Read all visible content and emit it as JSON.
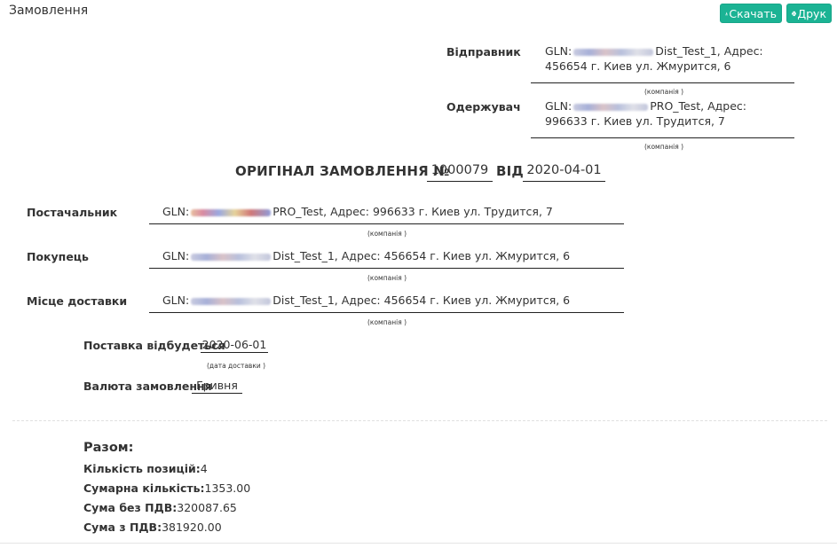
{
  "header": {
    "title": "Замовлення",
    "download_label": "Скачать",
    "print_label": "Друк",
    "accent_color": "#1bb394"
  },
  "sender": {
    "label": "Відправник",
    "gln_prefix": "GLN:",
    "line1_rest": "Dist_Test_1, Адрес:",
    "line2": "456654 г. Киев ул. Жмурится, 6",
    "caption": "(компанія )"
  },
  "recipient": {
    "label": "Одержувач",
    "gln_prefix": "GLN:",
    "line1_rest": "PRO_Test, Адрес:",
    "line2": "996633 г. Киев ул. Трудится, 7",
    "caption": "(компанія )"
  },
  "order_title": {
    "prefix": "ОРИГІНАЛ ЗАМОВЛЕННЯ №",
    "number": "1000079",
    "from_label": "ВІД",
    "date": "2020-04-01"
  },
  "parties": [
    {
      "label": "Постачальник",
      "gln_prefix": "GLN:",
      "rest": "PRO_Test, Адрес: 996633 г. Киев ул. Трудится, 7",
      "caption": "(компанія )"
    },
    {
      "label": "Покупець",
      "gln_prefix": "GLN:",
      "rest": "Dist_Test_1, Адрес: 456654 г. Киев ул. Жмурится, 6",
      "caption": "(компанія )"
    },
    {
      "label": "Місце доставки",
      "gln_prefix": "GLN:",
      "rest": "Dist_Test_1, Адрес: 456654 г. Киев ул. Жмурится, 6",
      "caption": "(компанія )"
    }
  ],
  "delivery": {
    "label": "Поставка відбудеться",
    "date": "2020-06-01",
    "caption": "(дата доставки )"
  },
  "currency": {
    "label": "Валюта замовлення",
    "value": "Гривня"
  },
  "summary": {
    "title": "Разом:",
    "positions_label": "Кількість позицій:",
    "positions_value": "4",
    "total_qty_label": "Сумарна кількість:",
    "total_qty_value": "1353.00",
    "sum_no_vat_label": "Сума без ПДВ:",
    "sum_no_vat_value": "320087.65",
    "sum_vat_label": "Сума з ПДВ:",
    "sum_vat_value": "381920.00"
  }
}
